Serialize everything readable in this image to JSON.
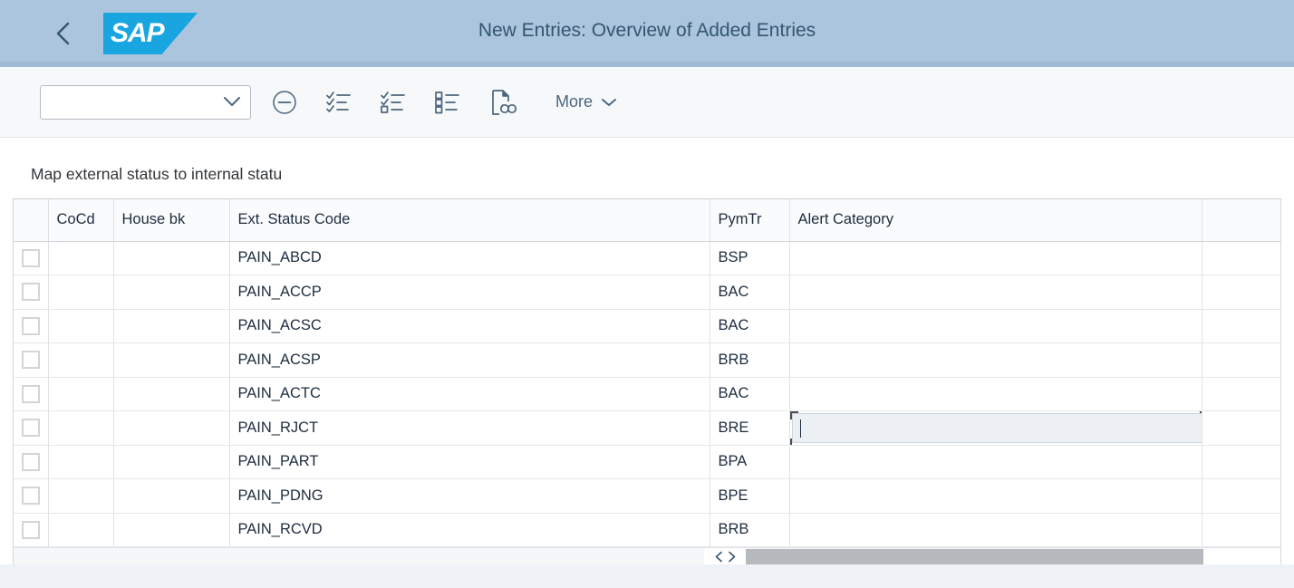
{
  "header": {
    "back_icon": "chevron-left-icon",
    "logo_text": "SAP",
    "title": "New Entries: Overview of Added Entries"
  },
  "toolbar": {
    "combo_value": "",
    "combo_placeholder": "",
    "combo_icon": "chevron-down-icon",
    "buttons": [
      {
        "name": "delete-row-button",
        "icon": "minus-circle-icon",
        "label": ""
      },
      {
        "name": "select-all-button",
        "icon": "checklist-all-icon",
        "label": ""
      },
      {
        "name": "select-block-button",
        "icon": "checklist-partial-icon",
        "label": ""
      },
      {
        "name": "list-items-button",
        "icon": "bullet-list-icon",
        "label": ""
      },
      {
        "name": "display-document-button",
        "icon": "document-glasses-icon",
        "label": ""
      }
    ],
    "more_label": "More",
    "more_icon": "chevron-down-icon"
  },
  "main": {
    "section_title": "Map external status to internal statu",
    "table": {
      "columns": [
        {
          "key": "select",
          "label": ""
        },
        {
          "key": "cocd",
          "label": "CoCd"
        },
        {
          "key": "house_bk",
          "label": "House bk"
        },
        {
          "key": "ext_status_code",
          "label": "Ext. Status Code"
        },
        {
          "key": "pym_tr",
          "label": "PymTr"
        },
        {
          "key": "alert_category",
          "label": "Alert Category"
        },
        {
          "key": "tail",
          "label": ""
        }
      ],
      "rows": [
        {
          "cocd": "",
          "house_bk": "",
          "ext_status_code": "PAIN_ABCD",
          "pym_tr": "BSP",
          "alert_category": "",
          "focused": false
        },
        {
          "cocd": "",
          "house_bk": "",
          "ext_status_code": "PAIN_ACCP",
          "pym_tr": "BAC",
          "alert_category": "",
          "focused": false
        },
        {
          "cocd": "",
          "house_bk": "",
          "ext_status_code": "PAIN_ACSC",
          "pym_tr": "BAC",
          "alert_category": "",
          "focused": false
        },
        {
          "cocd": "",
          "house_bk": "",
          "ext_status_code": "PAIN_ACSP",
          "pym_tr": "BRB",
          "alert_category": "",
          "focused": false
        },
        {
          "cocd": "",
          "house_bk": "",
          "ext_status_code": "PAIN_ACTC",
          "pym_tr": "BAC",
          "alert_category": "",
          "focused": false
        },
        {
          "cocd": "",
          "house_bk": "",
          "ext_status_code": "PAIN_RJCT",
          "pym_tr": "BRE",
          "alert_category": "",
          "focused": true
        },
        {
          "cocd": "",
          "house_bk": "",
          "ext_status_code": "PAIN_PART",
          "pym_tr": "BPA",
          "alert_category": "",
          "focused": false
        },
        {
          "cocd": "",
          "house_bk": "",
          "ext_status_code": "PAIN_PDNG",
          "pym_tr": "BPE",
          "alert_category": "",
          "focused": false
        },
        {
          "cocd": "",
          "house_bk": "",
          "ext_status_code": "PAIN_RCVD",
          "pym_tr": "BRB",
          "alert_category": "",
          "focused": false
        }
      ],
      "focused_cell": {
        "row_index": 5,
        "column": "alert_category",
        "value": "",
        "value_help_icon": "value-help-icon"
      },
      "horizontal_scroll": {
        "prev_icon": "chevron-left-icon",
        "next_icon": "chevron-right-icon"
      }
    }
  },
  "colors": {
    "shell_header_bg": "#abc5de",
    "shell_title_text": "#33566e",
    "logo_blue": "#19a5e0",
    "toolbar_bg": "#f7f8fa",
    "icon_blue": "#4a667d",
    "accent_blue": "#5b9bd5",
    "table_border": "#dfe2e6",
    "scroll_thumb": "#b6b9bd"
  }
}
